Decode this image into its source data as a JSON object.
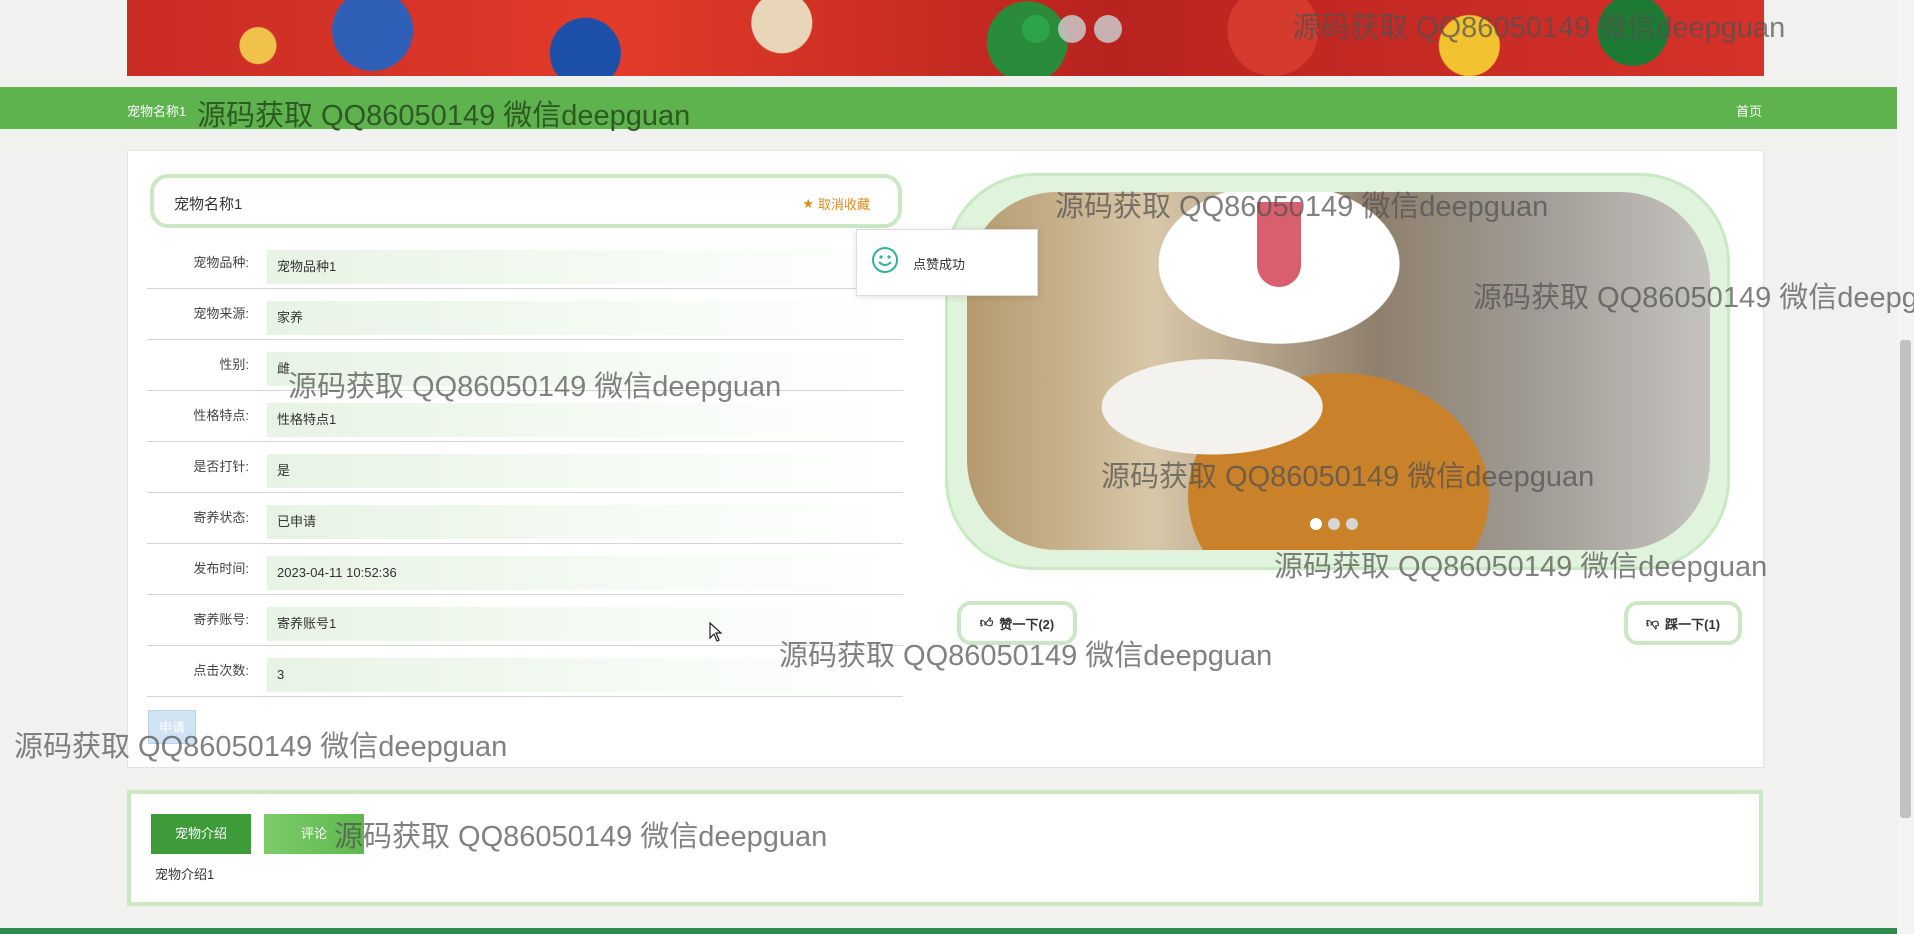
{
  "banner": {
    "slide_count": 3,
    "active_slide": 1
  },
  "nav": {
    "title": "宠物名称1",
    "home_link": "首页"
  },
  "detail": {
    "pet_name": "宠物名称1",
    "favorite_button": "取消收藏",
    "fields": [
      {
        "label": "宠物品种:",
        "value": "宠物品种1"
      },
      {
        "label": "宠物来源:",
        "value": "家养"
      },
      {
        "label": "性别:",
        "value": "雌"
      },
      {
        "label": "性格特点:",
        "value": "性格特点1"
      },
      {
        "label": "是否打针:",
        "value": "是"
      },
      {
        "label": "寄养状态:",
        "value": "已申请"
      },
      {
        "label": "发布时间:",
        "value": "2023-04-11 10:52:36"
      },
      {
        "label": "寄养账号:",
        "value": "寄养账号1"
      },
      {
        "label": "点击次数:",
        "value": "3"
      }
    ],
    "apply_button": "申请"
  },
  "toast": {
    "message": "点赞成功"
  },
  "carousel": {
    "slide_count": 3,
    "active_slide": 1
  },
  "votes": {
    "like_label": "赞一下(2)",
    "dislike_label": "踩一下(1)"
  },
  "tabs": {
    "items": [
      {
        "label": "宠物介绍",
        "active": true
      },
      {
        "label": "评论",
        "active": false
      }
    ],
    "content": "宠物介绍1"
  },
  "watermark": "源码获取 QQ86050149 微信deepguan",
  "colors": {
    "brand_green": "#5fb34e",
    "accent_border": "#cbe8c4",
    "fav_orange": "#e08a1e"
  }
}
